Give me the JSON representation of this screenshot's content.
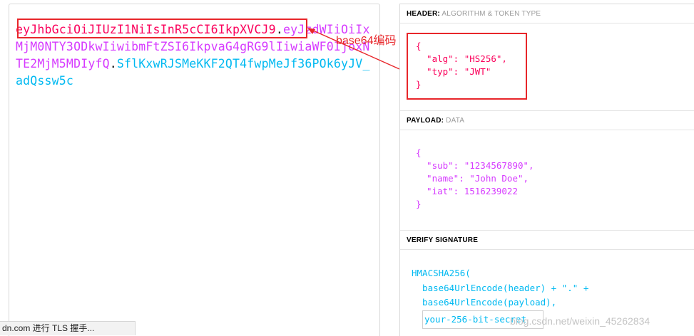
{
  "encoded": {
    "header_part": "eyJhbGciOiJIUzI1NiIsInR5cCI6IkpXVCJ9",
    "payload_part": "eyJzdWIiOiIxMjM0NTY3ODkwIiwibmFtZSI6IkpvaG4gRG9lIiwiaWF0IjoxNTE2MjM5MDIyfQ",
    "signature_part": "SflKxwRJSMeKKF2QT4fwpMeJf36POk6yJV_adQssw5c",
    "dot": "."
  },
  "annotation": {
    "label": "base64编码",
    "color": "#e8262a"
  },
  "status_bar": {
    "text": "dn.com 进行 TLS 握手..."
  },
  "header_section": {
    "title": "HEADER:",
    "subtitle": "ALGORITHM & TOKEN TYPE",
    "lines": [
      "{",
      "  \"alg\": \"HS256\",",
      "  \"typ\": \"JWT\"",
      "}"
    ]
  },
  "payload_section": {
    "title": "PAYLOAD:",
    "subtitle": "DATA",
    "lines": [
      "{",
      "  \"sub\": \"1234567890\",",
      "  \"name\": \"John Doe\",",
      "  \"iat\": 1516239022",
      "}"
    ]
  },
  "signature_section": {
    "title": "VERIFY SIGNATURE",
    "lines": [
      "HMACSHA256(",
      "  base64UrlEncode(header) + \".\" +",
      "  base64UrlEncode(payload),"
    ],
    "secret_value": "your-256-bit-secret"
  },
  "watermark": "blog.csdn.net/weixin_45262834",
  "colors": {
    "header": "#fb015b",
    "payload": "#d63aff",
    "signature": "#00b9f1",
    "annotation": "#e8262a"
  }
}
